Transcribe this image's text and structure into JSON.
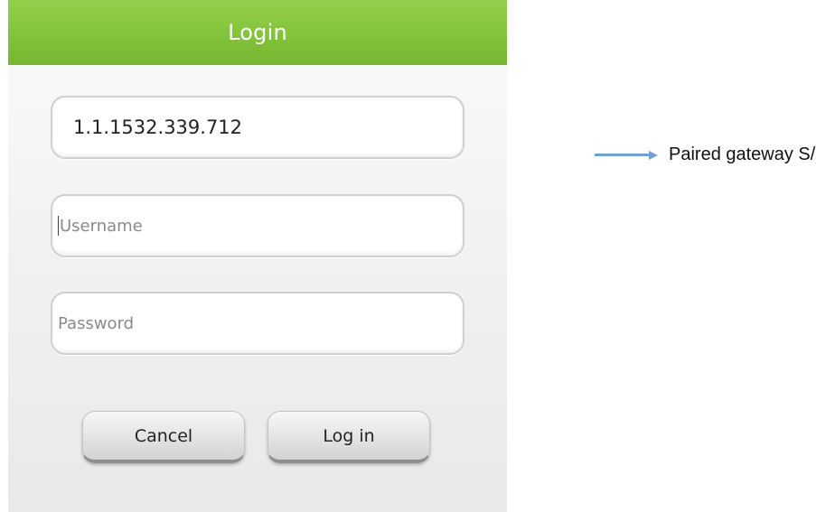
{
  "dialog": {
    "title": "Login",
    "serial_field": {
      "value": "1.1.1532.339.712"
    },
    "username_field": {
      "placeholder": "Username"
    },
    "password_field": {
      "placeholder": "Password"
    },
    "cancel_label": "Cancel",
    "login_label": "Log in",
    "colors": {
      "titlebar": "#82c23a",
      "title_text": "#ffffff"
    }
  },
  "annotation": {
    "label": "Paired gateway S/N",
    "arrow_icon": "arrow-right-icon",
    "arrow_color": "#6fa0cf"
  }
}
